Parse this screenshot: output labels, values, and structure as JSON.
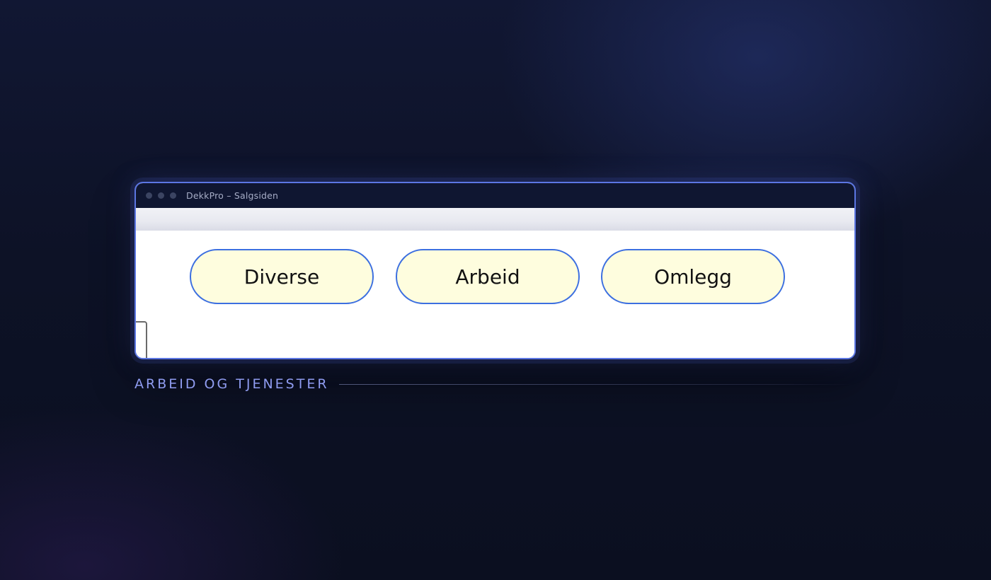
{
  "window": {
    "title": "DekkPro – Salgsiden"
  },
  "buttons": [
    {
      "label": "Diverse"
    },
    {
      "label": "Arbeid"
    },
    {
      "label": "Omlegg"
    }
  ],
  "caption": "ARBEID OG TJENESTER",
  "colors": {
    "accent": "#5b76e3",
    "button_border": "#3c6fe0",
    "button_fill": "#fefdde",
    "caption_text": "#8f9cf0",
    "titlebar_bg": "#0f1631"
  },
  "icons": {
    "window_controls": [
      "window-dot-icon",
      "window-dot-icon",
      "window-dot-icon"
    ]
  }
}
